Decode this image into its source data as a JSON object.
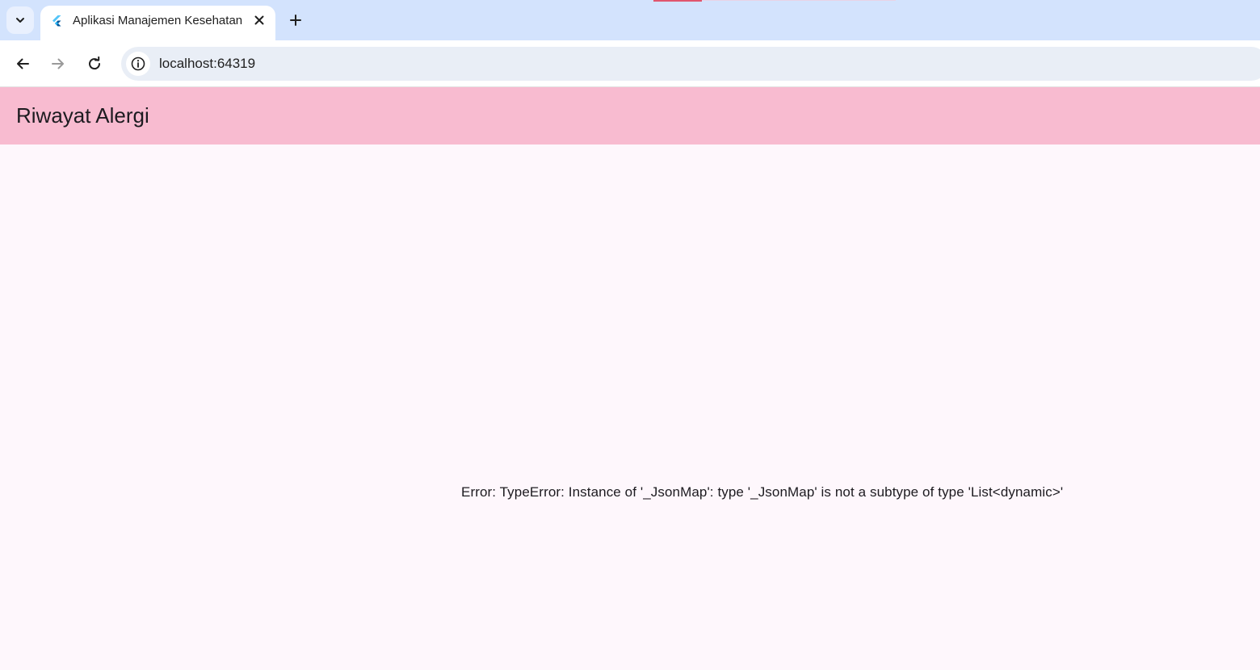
{
  "browser": {
    "tab": {
      "title": "Aplikasi Manajemen Kesehatan",
      "favicon": "flutter-icon"
    },
    "address_bar": {
      "url": "localhost:64319"
    },
    "icons": {
      "tab_search": "chevron-down-icon",
      "close": "close-icon",
      "new_tab": "plus-icon",
      "back": "arrow-left-icon",
      "forward": "arrow-right-icon",
      "reload": "reload-icon",
      "site_info": "info-icon"
    },
    "colors": {
      "tabstrip": "#d3e3fd",
      "omnibox": "#e9eef6"
    }
  },
  "app": {
    "appbar": {
      "title": "Riwayat Alergi",
      "color": "#f8bbd0"
    },
    "body": {
      "error_message": "Error: TypeError: Instance of '_JsonMap': type '_JsonMap' is not a subtype of type 'List<dynamic>'",
      "background": "#fef7fc"
    }
  }
}
